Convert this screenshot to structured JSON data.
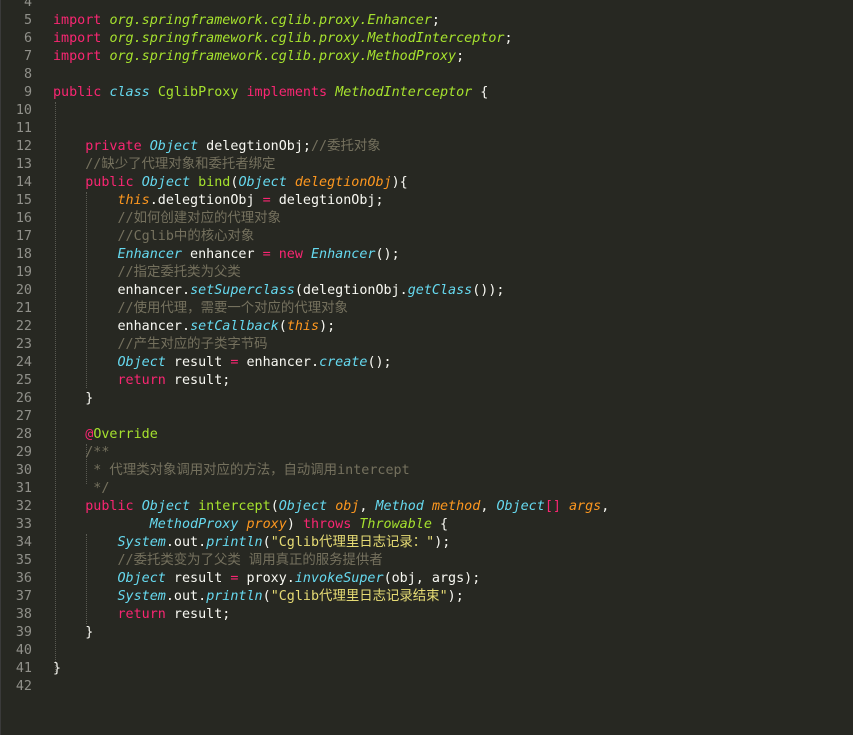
{
  "lines": [
    {
      "n": "4",
      "t": []
    },
    {
      "n": "5",
      "t": [
        {
          "s": "kw",
          "v": "import"
        },
        {
          "s": "pl",
          "v": " "
        },
        {
          "s": "fn it",
          "v": "org.springframework.cglib.proxy.Enhancer"
        },
        {
          "s": "pl",
          "v": ";"
        }
      ]
    },
    {
      "n": "6",
      "t": [
        {
          "s": "kw",
          "v": "import"
        },
        {
          "s": "pl",
          "v": " "
        },
        {
          "s": "fn it",
          "v": "org.springframework.cglib.proxy.MethodInterceptor"
        },
        {
          "s": "pl",
          "v": ";"
        }
      ]
    },
    {
      "n": "7",
      "t": [
        {
          "s": "kw",
          "v": "import"
        },
        {
          "s": "pl",
          "v": " "
        },
        {
          "s": "fn it",
          "v": "org.springframework.cglib.proxy.MethodProxy"
        },
        {
          "s": "pl",
          "v": ";"
        }
      ]
    },
    {
      "n": "8",
      "t": []
    },
    {
      "n": "9",
      "t": [
        {
          "s": "kw",
          "v": "public"
        },
        {
          "s": "pl",
          "v": " "
        },
        {
          "s": "ty",
          "v": "class"
        },
        {
          "s": "pl",
          "v": " "
        },
        {
          "s": "fn",
          "v": "CglibProxy"
        },
        {
          "s": "pl",
          "v": " "
        },
        {
          "s": "kw",
          "v": "implements"
        },
        {
          "s": "pl",
          "v": " "
        },
        {
          "s": "fn it",
          "v": "MethodInterceptor"
        },
        {
          "s": "pl",
          "v": " {"
        }
      ]
    },
    {
      "n": "10",
      "t": []
    },
    {
      "n": "11",
      "t": []
    },
    {
      "n": "12",
      "t": [
        {
          "s": "pl",
          "v": "    "
        },
        {
          "s": "kw",
          "v": "private"
        },
        {
          "s": "pl",
          "v": " "
        },
        {
          "s": "ty",
          "v": "Object"
        },
        {
          "s": "pl",
          "v": " delegtionObj;"
        },
        {
          "s": "cm",
          "v": "//委托对象"
        }
      ]
    },
    {
      "n": "13",
      "t": [
        {
          "s": "pl",
          "v": "    "
        },
        {
          "s": "cm",
          "v": "//缺少了代理对象和委托者绑定"
        }
      ]
    },
    {
      "n": "14",
      "t": [
        {
          "s": "pl",
          "v": "    "
        },
        {
          "s": "kw",
          "v": "public"
        },
        {
          "s": "pl",
          "v": " "
        },
        {
          "s": "ty",
          "v": "Object"
        },
        {
          "s": "pl",
          "v": " "
        },
        {
          "s": "fn",
          "v": "bind"
        },
        {
          "s": "pl",
          "v": "("
        },
        {
          "s": "ty",
          "v": "Object"
        },
        {
          "s": "pl",
          "v": " "
        },
        {
          "s": "pa",
          "v": "delegtionObj"
        },
        {
          "s": "pl",
          "v": "){"
        }
      ]
    },
    {
      "n": "15",
      "t": [
        {
          "s": "pl",
          "v": "        "
        },
        {
          "s": "pa",
          "v": "this"
        },
        {
          "s": "pl",
          "v": ".delegtionObj "
        },
        {
          "s": "kw",
          "v": "="
        },
        {
          "s": "pl",
          "v": " delegtionObj;"
        }
      ]
    },
    {
      "n": "16",
      "t": [
        {
          "s": "pl",
          "v": "        "
        },
        {
          "s": "cm",
          "v": "//如何创建对应的代理对象"
        }
      ]
    },
    {
      "n": "17",
      "t": [
        {
          "s": "pl",
          "v": "        "
        },
        {
          "s": "cm",
          "v": "//Cglib中的核心对象"
        }
      ]
    },
    {
      "n": "18",
      "t": [
        {
          "s": "pl",
          "v": "        "
        },
        {
          "s": "ty",
          "v": "Enhancer"
        },
        {
          "s": "pl",
          "v": " enhancer "
        },
        {
          "s": "kw",
          "v": "="
        },
        {
          "s": "pl",
          "v": " "
        },
        {
          "s": "kw",
          "v": "new"
        },
        {
          "s": "pl",
          "v": " "
        },
        {
          "s": "ty",
          "v": "Enhancer"
        },
        {
          "s": "pl",
          "v": "();"
        }
      ]
    },
    {
      "n": "19",
      "t": [
        {
          "s": "pl",
          "v": "        "
        },
        {
          "s": "cm",
          "v": "//指定委托类为父类"
        }
      ]
    },
    {
      "n": "20",
      "t": [
        {
          "s": "pl",
          "v": "        enhancer."
        },
        {
          "s": "ty",
          "v": "setSuperclass"
        },
        {
          "s": "pl",
          "v": "(delegtionObj."
        },
        {
          "s": "ty",
          "v": "getClass"
        },
        {
          "s": "pl",
          "v": "());"
        }
      ]
    },
    {
      "n": "21",
      "t": [
        {
          "s": "pl",
          "v": "        "
        },
        {
          "s": "cm",
          "v": "//使用代理，需要一个对应的代理对象"
        }
      ]
    },
    {
      "n": "22",
      "t": [
        {
          "s": "pl",
          "v": "        enhancer."
        },
        {
          "s": "ty",
          "v": "setCallback"
        },
        {
          "s": "pl",
          "v": "("
        },
        {
          "s": "pa",
          "v": "this"
        },
        {
          "s": "pl",
          "v": ");"
        }
      ]
    },
    {
      "n": "23",
      "t": [
        {
          "s": "pl",
          "v": "        "
        },
        {
          "s": "cm",
          "v": "//产生对应的子类字节码"
        }
      ]
    },
    {
      "n": "24",
      "t": [
        {
          "s": "pl",
          "v": "        "
        },
        {
          "s": "ty",
          "v": "Object"
        },
        {
          "s": "pl",
          "v": " result "
        },
        {
          "s": "kw",
          "v": "="
        },
        {
          "s": "pl",
          "v": " enhancer."
        },
        {
          "s": "ty",
          "v": "create"
        },
        {
          "s": "pl",
          "v": "();"
        }
      ]
    },
    {
      "n": "25",
      "t": [
        {
          "s": "pl",
          "v": "        "
        },
        {
          "s": "kw",
          "v": "return"
        },
        {
          "s": "pl",
          "v": " result;"
        }
      ]
    },
    {
      "n": "26",
      "t": [
        {
          "s": "pl",
          "v": "    }"
        }
      ]
    },
    {
      "n": "27",
      "t": []
    },
    {
      "n": "28",
      "t": [
        {
          "s": "pl",
          "v": "    "
        },
        {
          "s": "kw",
          "v": "@"
        },
        {
          "s": "fn",
          "v": "Override"
        }
      ]
    },
    {
      "n": "29",
      "t": [
        {
          "s": "pl",
          "v": "    "
        },
        {
          "s": "cm",
          "v": "/**"
        }
      ]
    },
    {
      "n": "30",
      "t": [
        {
          "s": "pl",
          "v": "    "
        },
        {
          "s": "cm",
          "v": " * 代理类对象调用对应的方法，自动调用intercept"
        }
      ]
    },
    {
      "n": "31",
      "t": [
        {
          "s": "pl",
          "v": "    "
        },
        {
          "s": "cm",
          "v": " */"
        }
      ]
    },
    {
      "n": "32",
      "t": [
        {
          "s": "pl",
          "v": "    "
        },
        {
          "s": "kw",
          "v": "public"
        },
        {
          "s": "pl",
          "v": " "
        },
        {
          "s": "ty",
          "v": "Object"
        },
        {
          "s": "pl",
          "v": " "
        },
        {
          "s": "fn",
          "v": "intercept"
        },
        {
          "s": "pl",
          "v": "("
        },
        {
          "s": "ty",
          "v": "Object"
        },
        {
          "s": "pl",
          "v": " "
        },
        {
          "s": "pa",
          "v": "obj"
        },
        {
          "s": "pl",
          "v": ", "
        },
        {
          "s": "ty",
          "v": "Method"
        },
        {
          "s": "pl",
          "v": " "
        },
        {
          "s": "pa",
          "v": "method"
        },
        {
          "s": "pl",
          "v": ", "
        },
        {
          "s": "ty",
          "v": "Object"
        },
        {
          "s": "kw",
          "v": "[]"
        },
        {
          "s": "pl",
          "v": " "
        },
        {
          "s": "pa",
          "v": "args"
        },
        {
          "s": "pl",
          "v": ","
        }
      ]
    },
    {
      "n": "33",
      "t": [
        {
          "s": "pl",
          "v": "            "
        },
        {
          "s": "ty",
          "v": "MethodProxy"
        },
        {
          "s": "pl",
          "v": " "
        },
        {
          "s": "pa",
          "v": "proxy"
        },
        {
          "s": "pl",
          "v": ") "
        },
        {
          "s": "kw",
          "v": "throws"
        },
        {
          "s": "pl",
          "v": " "
        },
        {
          "s": "fn it",
          "v": "Throwable"
        },
        {
          "s": "pl",
          "v": " {"
        }
      ]
    },
    {
      "n": "34",
      "t": [
        {
          "s": "pl",
          "v": "        "
        },
        {
          "s": "ty",
          "v": "System"
        },
        {
          "s": "pl",
          "v": ".out."
        },
        {
          "s": "ty",
          "v": "println"
        },
        {
          "s": "pl",
          "v": "("
        },
        {
          "s": "st",
          "v": "\"Cglib代理里日志记录：\""
        },
        {
          "s": "pl",
          "v": ");"
        }
      ]
    },
    {
      "n": "35",
      "t": [
        {
          "s": "pl",
          "v": "        "
        },
        {
          "s": "cm",
          "v": "//委托类变为了父类 调用真正的服务提供者"
        }
      ]
    },
    {
      "n": "36",
      "t": [
        {
          "s": "pl",
          "v": "        "
        },
        {
          "s": "ty",
          "v": "Object"
        },
        {
          "s": "pl",
          "v": " result "
        },
        {
          "s": "kw",
          "v": "="
        },
        {
          "s": "pl",
          "v": " proxy."
        },
        {
          "s": "ty",
          "v": "invokeSuper"
        },
        {
          "s": "pl",
          "v": "(obj, args);"
        }
      ]
    },
    {
      "n": "37",
      "t": [
        {
          "s": "pl",
          "v": "        "
        },
        {
          "s": "ty",
          "v": "System"
        },
        {
          "s": "pl",
          "v": ".out."
        },
        {
          "s": "ty",
          "v": "println"
        },
        {
          "s": "pl",
          "v": "("
        },
        {
          "s": "st",
          "v": "\"Cglib代理里日志记录结束\""
        },
        {
          "s": "pl",
          "v": ");"
        }
      ]
    },
    {
      "n": "38",
      "t": [
        {
          "s": "pl",
          "v": "        "
        },
        {
          "s": "kw",
          "v": "return"
        },
        {
          "s": "pl",
          "v": " result;"
        }
      ]
    },
    {
      "n": "39",
      "t": [
        {
          "s": "pl",
          "v": "    }"
        }
      ]
    },
    {
      "n": "40",
      "t": []
    },
    {
      "n": "41",
      "t": [
        {
          "s": "pl",
          "v": "}"
        }
      ]
    },
    {
      "n": "42",
      "t": []
    }
  ],
  "colors": {
    "background": "#272822",
    "keyword": "#f92672",
    "type": "#66d9ef",
    "function": "#a6e22e",
    "parameter": "#fd971f",
    "string": "#e6db74",
    "comment": "#75715e",
    "text": "#f8f8f2",
    "gutter": "#90908a"
  }
}
